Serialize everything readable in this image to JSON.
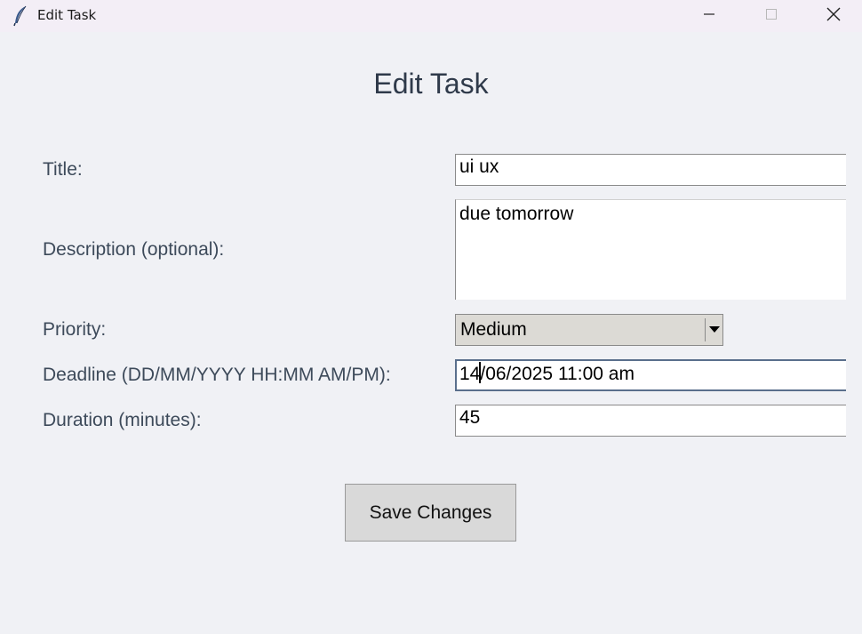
{
  "window": {
    "title": "Edit Task",
    "icon": "feather-icon",
    "controls": [
      "minimize-icon",
      "maximize-icon",
      "close-icon"
    ]
  },
  "form": {
    "heading": "Edit Task",
    "title_label": "Title:",
    "title_value": "ui ux",
    "description_label": "Description (optional):",
    "description_value": "due tomorrow",
    "priority_label": "Priority:",
    "priority_value": "Medium",
    "deadline_label": "Deadline (DD/MM/YYYY HH:MM AM/PM):",
    "deadline_value_before_caret": "14",
    "deadline_value_after_caret": "/06/2025 11:00 am",
    "duration_label": "Duration (minutes):",
    "duration_value": "45",
    "save_label": "Save Changes"
  },
  "colors": {
    "background": "#f0f1f5",
    "titlebar": "#f3eef6",
    "label_text": "#3d4a5a",
    "focus_border": "#5a6f8c",
    "button_bg": "#d9d9d9",
    "combobox_bg": "#dcdad5"
  }
}
